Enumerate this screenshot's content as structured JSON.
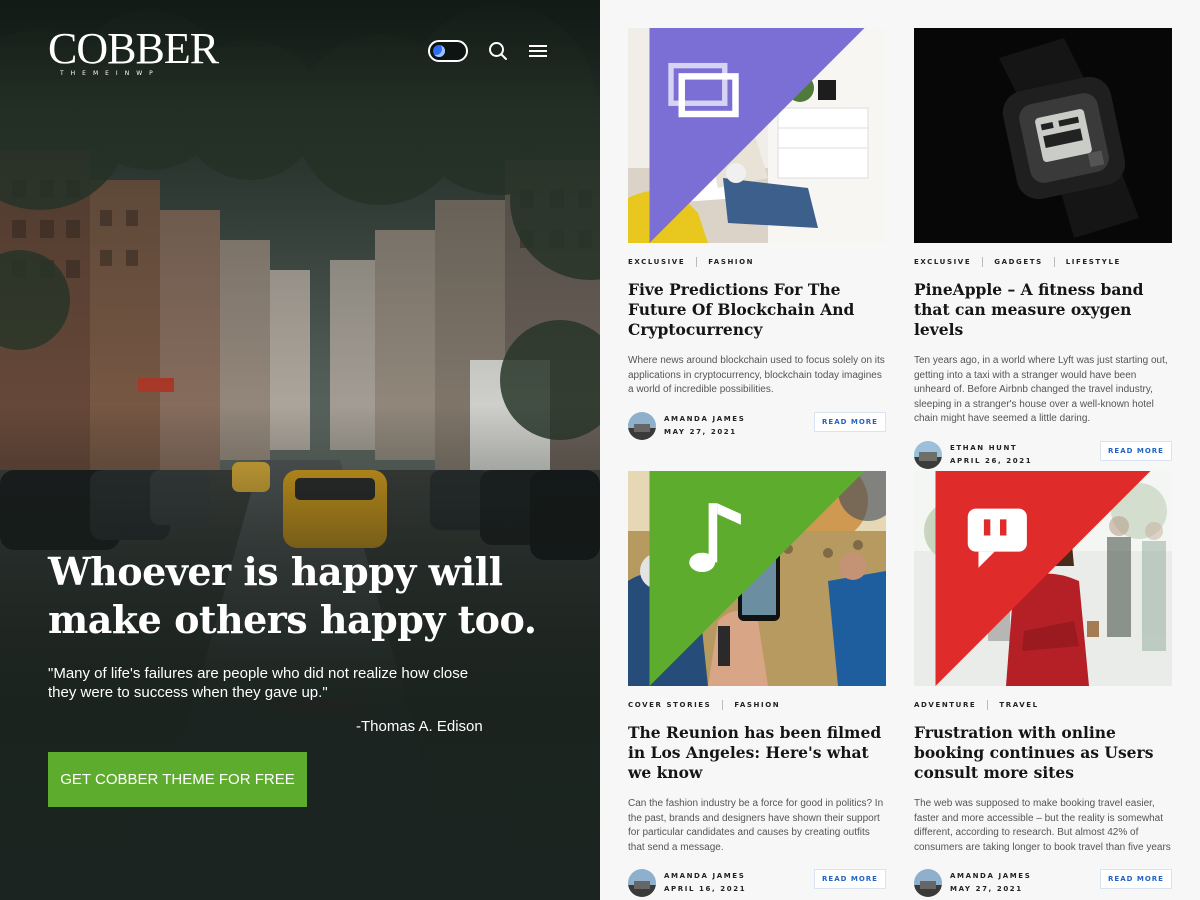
{
  "brand": {
    "logo_text": "COBBER",
    "logo_sub": "THEMEINWP"
  },
  "header": {
    "icons": [
      "moon-icon",
      "search-icon",
      "menu-icon"
    ]
  },
  "hero": {
    "title": "Whoever is happy will make others happy too.",
    "quote": "\"Many of life's failures are people who did not realize how close they were to success when they gave up.\"",
    "author": "-Thomas A. Edison",
    "cta_label": "GET COBBER THEME FOR FREE",
    "cta_color": "#5eac2e"
  },
  "posts": [
    {
      "format_icon": "gallery-icon",
      "format_color": "#7b6fd6",
      "categories": [
        "EXCLUSIVE",
        "FASHION"
      ],
      "title": "Five Predictions For The Future Of Blockchain And Cryptocurrency",
      "excerpt": "Where news around blockchain used to focus solely on its applications in cryptocurrency, blockchain today imagines a world of incredible possibilities.",
      "author": "AMANDA JAMES",
      "date": "MAY 27, 2021",
      "read_more": "READ MORE"
    },
    {
      "format_icon": "",
      "format_color": "",
      "categories": [
        "EXCLUSIVE",
        "GADGETS",
        "LIFESTYLE"
      ],
      "title": "PineApple – A fitness band that can measure oxygen levels",
      "excerpt": "Ten years ago, in a world where Lyft was just starting out, getting into a taxi with a stranger would have been unheard of. Before Airbnb changed the travel industry, sleeping in a stranger's house over a well-known hotel chain might have seemed a little daring.",
      "author": "ETHAN HUNT",
      "date": "APRIL 26, 2021",
      "read_more": "READ MORE"
    },
    {
      "format_icon": "music-icon",
      "format_color": "#5eac2e",
      "categories": [
        "COVER STORIES",
        "FASHION"
      ],
      "title": "The Reunion has been filmed in Los Angeles: Here's what we know",
      "excerpt": "Can the fashion industry be a force for good in politics? In the past, brands and designers have shown their support for particular candidates and causes by creating outfits that send a message.",
      "author": "AMANDA JAMES",
      "date": "APRIL 16, 2021",
      "read_more": "READ MORE"
    },
    {
      "format_icon": "chat-icon",
      "format_color": "#e02b2b",
      "categories": [
        "ADVENTURE",
        "TRAVEL"
      ],
      "title": "Frustration with online booking continues as Users consult more sites",
      "excerpt": "The web was supposed to make booking travel easier, faster and more accessible – but the reality is somewhat different, according to research. But almost 42% of consumers are taking longer to book travel than five years",
      "author": "AMANDA JAMES",
      "date": "MAY 27, 2021",
      "read_more": "READ MORE"
    }
  ]
}
